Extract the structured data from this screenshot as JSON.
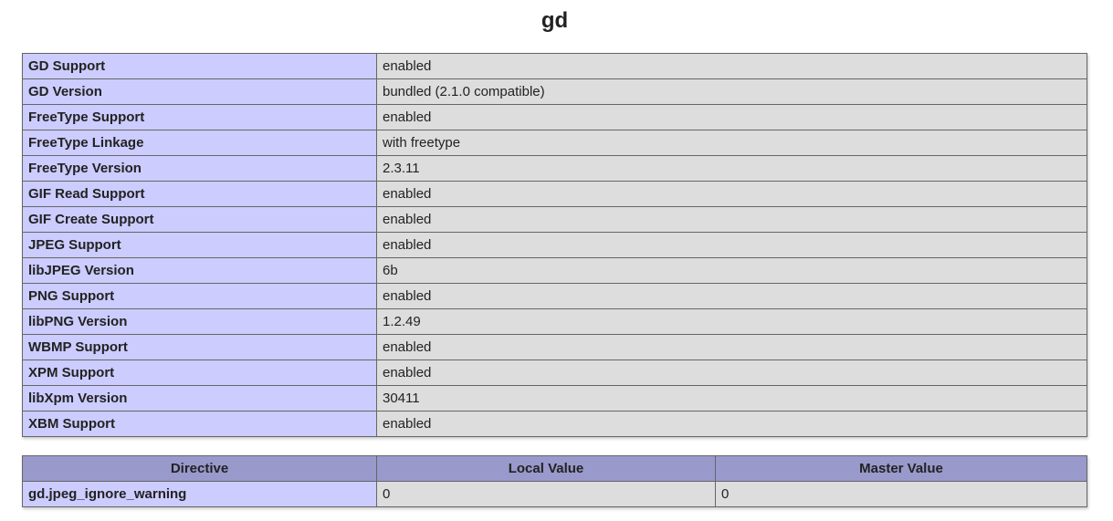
{
  "title": "gd",
  "properties": [
    {
      "name": "GD Support",
      "value": "enabled"
    },
    {
      "name": "GD Version",
      "value": "bundled (2.1.0 compatible)"
    },
    {
      "name": "FreeType Support",
      "value": "enabled"
    },
    {
      "name": "FreeType Linkage",
      "value": "with freetype"
    },
    {
      "name": "FreeType Version",
      "value": "2.3.11"
    },
    {
      "name": "GIF Read Support",
      "value": "enabled"
    },
    {
      "name": "GIF Create Support",
      "value": "enabled"
    },
    {
      "name": "JPEG Support",
      "value": "enabled"
    },
    {
      "name": "libJPEG Version",
      "value": "6b"
    },
    {
      "name": "PNG Support",
      "value": "enabled"
    },
    {
      "name": "libPNG Version",
      "value": "1.2.49"
    },
    {
      "name": "WBMP Support",
      "value": "enabled"
    },
    {
      "name": "XPM Support",
      "value": "enabled"
    },
    {
      "name": "libXpm Version",
      "value": "30411"
    },
    {
      "name": "XBM Support",
      "value": "enabled"
    }
  ],
  "directives": {
    "headers": {
      "directive": "Directive",
      "local": "Local Value",
      "master": "Master Value"
    },
    "rows": [
      {
        "directive": "gd.jpeg_ignore_warning",
        "local": "0",
        "master": "0"
      }
    ]
  },
  "colors": {
    "label_cell": "#ccccff",
    "value_cell": "#dddddd",
    "header_cell": "#9999cc",
    "border": "#666666"
  }
}
